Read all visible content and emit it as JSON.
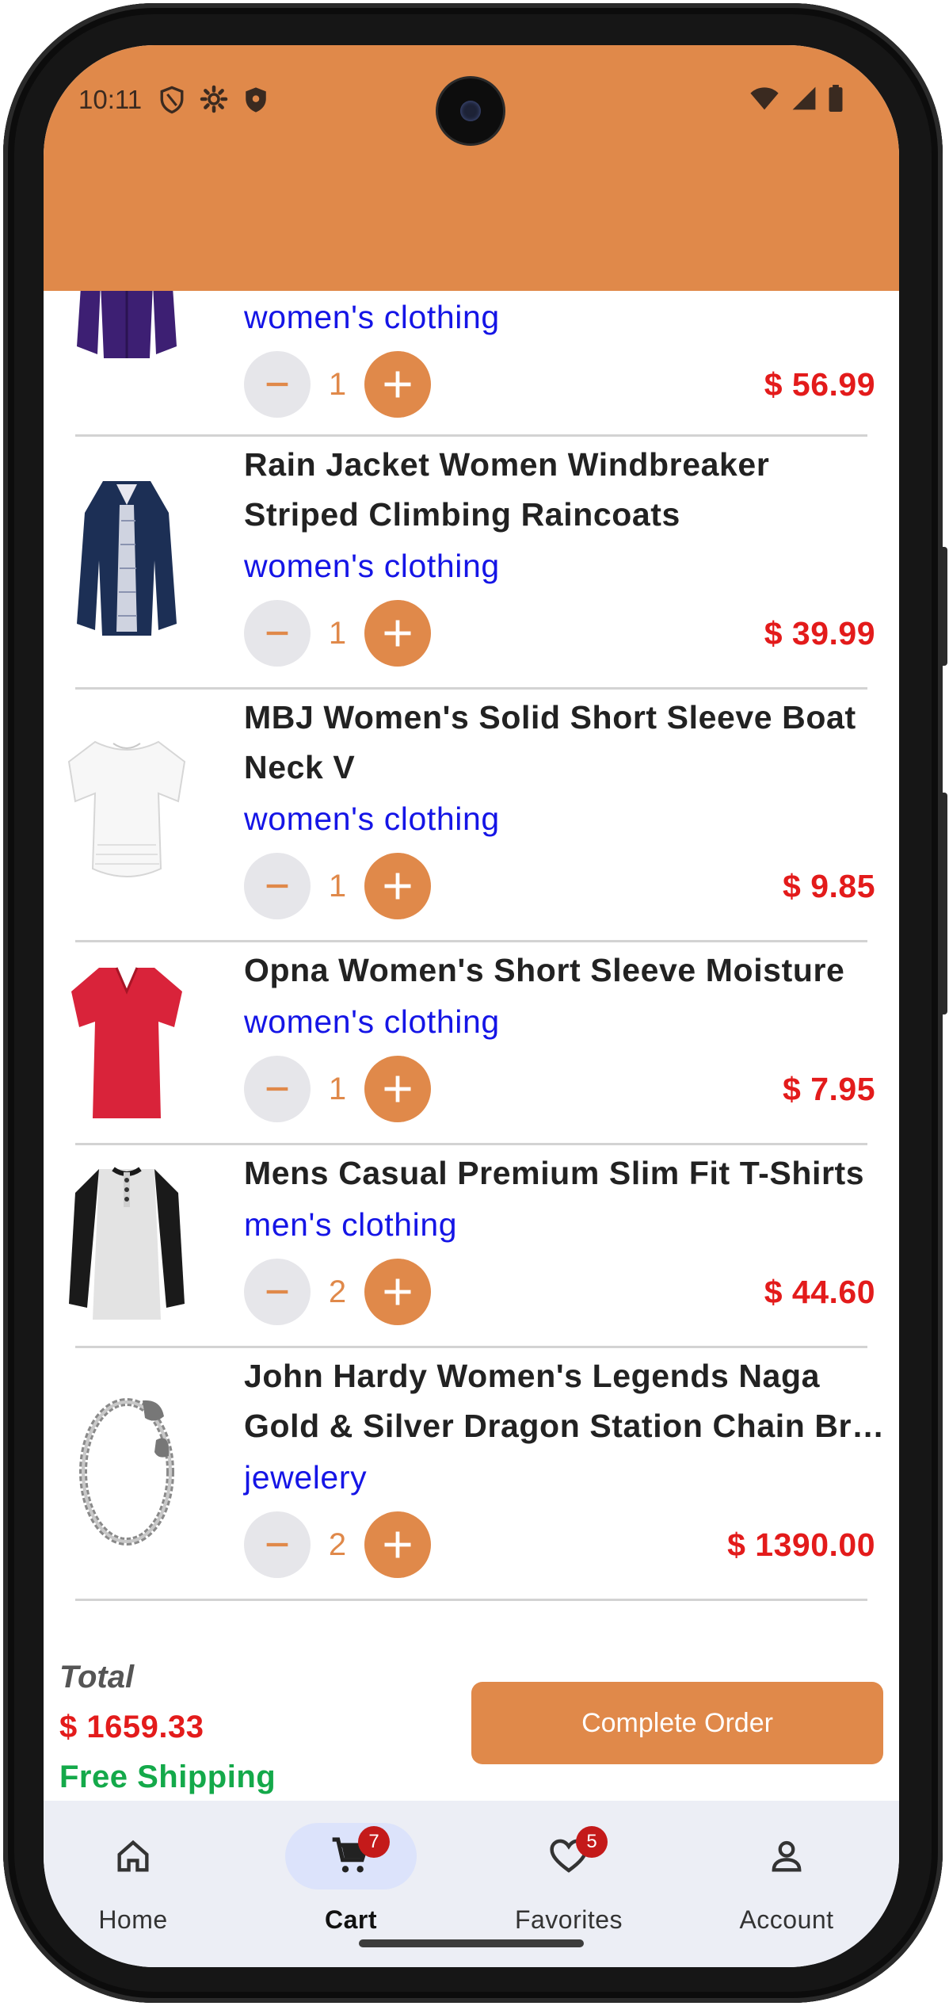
{
  "status_bar": {
    "time": "10:11",
    "left_icons": [
      "shield-outline-icon",
      "settings-icon",
      "shield-filled-icon"
    ],
    "right_icons": [
      "wifi-icon",
      "signal-icon",
      "battery-icon"
    ]
  },
  "theme": {
    "accent": "#E0894A",
    "price_color": "#e31b1b",
    "category_color": "#1515e6",
    "shipping_color": "#14a94a"
  },
  "cart_items": [
    {
      "title": "",
      "category": "women's clothing",
      "quantity": "1",
      "price": "$ 56.99",
      "image": "purple-jacket"
    },
    {
      "title_lines": [
        "Rain Jacket Women Windbreaker",
        "Striped Climbing Raincoats"
      ],
      "category": "women's clothing",
      "quantity": "1",
      "price": "$ 39.99",
      "image": "navy-raincoat"
    },
    {
      "title_lines": [
        "MBJ Women's Solid Short Sleeve Boat",
        "Neck V"
      ],
      "category": "women's clothing",
      "quantity": "1",
      "price": "$ 9.85",
      "image": "white-tshirt"
    },
    {
      "title_lines": [
        "Opna Women's Short Sleeve Moisture"
      ],
      "category": "women's clothing",
      "quantity": "1",
      "price": "$ 7.95",
      "image": "red-tshirt"
    },
    {
      "title_lines": [
        "Mens Casual Premium Slim Fit T-Shirts"
      ],
      "category": "men's clothing",
      "quantity": "2",
      "price": "$ 44.60",
      "image": "raglan-henley"
    },
    {
      "title_lines": [
        "John Hardy Women's Legends Naga",
        "Gold & Silver Dragon Station Chain Bra..."
      ],
      "category": "jewelery",
      "quantity": "2",
      "price": "$ 1390.00",
      "image": "dragon-bracelet"
    }
  ],
  "summary": {
    "total_label": "Total",
    "total_value": "$ 1659.33",
    "shipping": "Free Shipping",
    "complete_button": "Complete Order"
  },
  "bottom_nav": [
    {
      "label": "Home",
      "icon": "home-icon",
      "active": false,
      "badge": ""
    },
    {
      "label": "Cart",
      "icon": "cart-icon",
      "active": true,
      "badge": "7"
    },
    {
      "label": "Favorites",
      "icon": "heart-icon",
      "active": false,
      "badge": "5"
    },
    {
      "label": "Account",
      "icon": "person-icon",
      "active": false,
      "badge": ""
    }
  ]
}
